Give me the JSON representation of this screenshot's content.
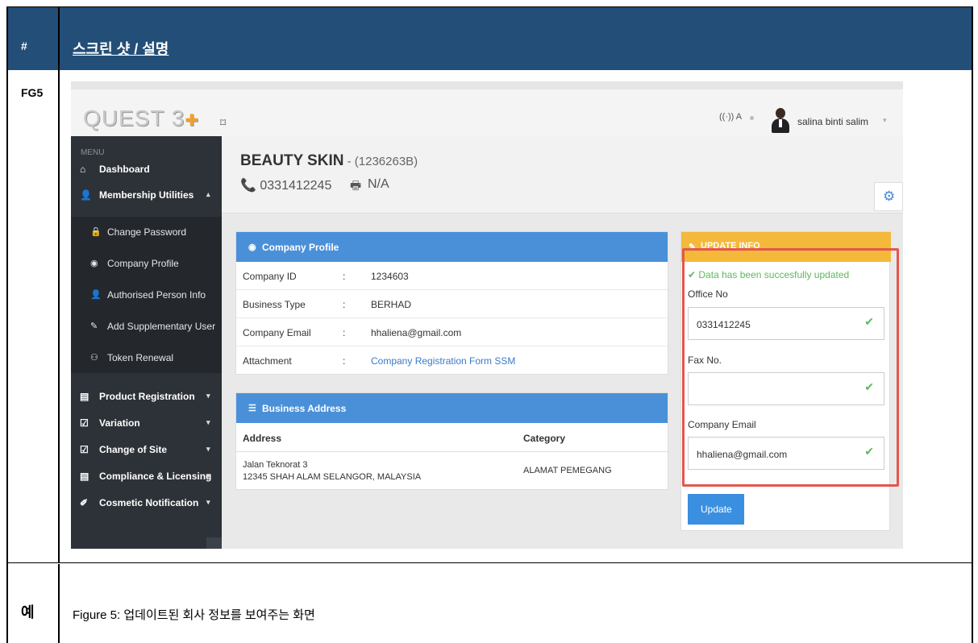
{
  "table": {
    "col1_header": "#",
    "col2_header": "스크린 샷 / 설명",
    "row1_label": "FG5",
    "row2_label": "예",
    "caption": "Figure 5: 업데이트된 회사 정보를 보여주는 화면"
  },
  "app": {
    "logo": "QUEST 3",
    "logo_plus": "✚",
    "user_name": "salina binti salim",
    "icons": {
      "toggle": "⌑",
      "signal": "((·)) A",
      "user_caret": "▾"
    }
  },
  "sidebar": {
    "menu_label": "MENU",
    "items": [
      {
        "label": "Dashboard",
        "icon": "home-icon",
        "glyph": "⌂"
      },
      {
        "label": "Membership Utilities",
        "icon": "user-icon",
        "glyph": "👤",
        "caret": "▴"
      }
    ],
    "sub_items": [
      {
        "label": "Change Password",
        "icon": "lock-icon",
        "glyph": "🔒"
      },
      {
        "label": "Company Profile",
        "icon": "eye-icon",
        "glyph": "◉"
      },
      {
        "label": "Authorised Person Info",
        "icon": "user-icon",
        "glyph": "👤"
      },
      {
        "label": "Add Supplementary User",
        "icon": "pencil-icon",
        "glyph": "✎"
      },
      {
        "label": "Token Renewal",
        "icon": "user-plus-icon",
        "glyph": "⚇"
      }
    ],
    "groups": [
      {
        "label": "Product Registration",
        "icon": "document-icon",
        "glyph": "▤",
        "caret": "▾"
      },
      {
        "label": "Variation",
        "icon": "edit-icon",
        "glyph": "☑",
        "caret": "▾"
      },
      {
        "label": "Change of Site",
        "icon": "edit-icon",
        "glyph": "☑",
        "caret": "▾"
      },
      {
        "label": "Compliance & Licensing",
        "icon": "document-icon",
        "glyph": "▤",
        "caret": "▾"
      },
      {
        "label": "Cosmetic Notification",
        "icon": "brush-icon",
        "glyph": "✐",
        "caret": "▾"
      }
    ]
  },
  "header": {
    "company": "BEAUTY SKIN",
    "reg_no": " - (1236263B)",
    "phone": "📞 0331412245",
    "fax_icon": "🖶",
    "fax": "N/A",
    "gear": "⚙"
  },
  "profile": {
    "title": "Company Profile",
    "title_icon": "◉",
    "rows": [
      {
        "key": "Company ID",
        "sep": ":",
        "value": "1234603"
      },
      {
        "key": "Business Type",
        "sep": ":",
        "value": "BERHAD"
      },
      {
        "key": "Company Email",
        "sep": ":",
        "value": "hhaliena@gmail.com"
      },
      {
        "key": "Attachment",
        "sep": ":",
        "value": "Company Registration Form SSM"
      }
    ]
  },
  "address": {
    "title": "Business Address",
    "title_icon": "☰",
    "col_address": "Address",
    "col_category": "Category",
    "line1": "Jalan Teknorat 3",
    "line2": "12345 SHAH ALAM SELANGOR, MALAYSIA",
    "category": "ALAMAT PEMEGANG"
  },
  "update": {
    "title": "UPDATE INFO",
    "title_icon": "✎",
    "success": "✔ Data has been succesfully updated",
    "office_label": "Office No",
    "office_value": "0331412245",
    "fax_label": "Fax No.",
    "fax_value": "",
    "email_label": "Company Email",
    "email_value": "hhaliena@gmail.com",
    "check": "✔",
    "button": "Update"
  },
  "colors": {
    "header_bg": "#234e77",
    "sidebar_bg": "#2d3238",
    "panel_blue": "#4a90d9",
    "panel_orange": "#f4b93a",
    "success_green": "#5cb85c",
    "highlight_red": "#e2574c"
  }
}
